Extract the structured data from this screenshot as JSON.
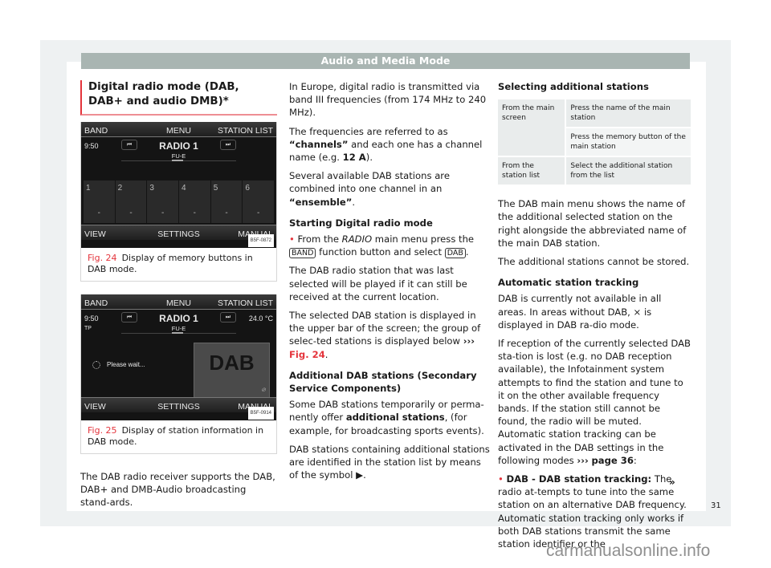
{
  "header": {
    "title": "Audio and Media Mode"
  },
  "section": {
    "title": "Digital radio mode (DAB, DAB+ and audio DMB)*"
  },
  "figures": [
    {
      "label": "Fig. 24",
      "caption": "Display of memory buttons in DAB mode.",
      "screen": {
        "top_left": "BAND",
        "top_center": "MENU",
        "top_right": "STATION LIST",
        "time": "9:50",
        "station": "RADIO 1",
        "sub": "FU-E",
        "prev_icon": "⏮",
        "next_icon": "⏭",
        "presets": [
          {
            "number": "1",
            "name": "-"
          },
          {
            "number": "2",
            "name": "-"
          },
          {
            "number": "3",
            "name": "-"
          },
          {
            "number": "4",
            "name": "-"
          },
          {
            "number": "5",
            "name": "-"
          },
          {
            "number": "6",
            "name": "-"
          }
        ],
        "page_dots": "• • •",
        "bottom_left": "VIEW",
        "bottom_center": "SETTINGS",
        "bottom_right": "MANUAL",
        "code": "B5F-0872"
      }
    },
    {
      "label": "Fig. 25",
      "caption": "Display of station information in DAB mode.",
      "screen": {
        "top_left": "BAND",
        "top_center": "MENU",
        "top_right": "STATION LIST",
        "time": "9:50",
        "tp": "TP",
        "temperature": "24.0 °C",
        "station": "RADIO 1",
        "sub": "FU-E",
        "prev_icon": "⏮",
        "next_icon": "⏭",
        "status": "Please wait...",
        "logo": "DAB",
        "no_image_icon": "⊘",
        "bottom_left": "VIEW",
        "bottom_center": "SETTINGS",
        "bottom_right": "MANUAL",
        "code": "B5F-0914"
      }
    }
  ],
  "col1": {
    "para": "The DAB radio receiver supports the DAB, DAB+ and DMB-Audio broadcasting stand-ards."
  },
  "col2": {
    "p1": "In Europe, digital radio is transmitted via band III frequencies (from 174 MHz to 240 MHz).",
    "p2_a": "The frequencies are referred to as ",
    "p2_b": "“channels”",
    "p2_c": " and each one has a channel name (e.g. ",
    "p2_d": "12  A",
    "p2_e": ").",
    "p3_a": "Several available DAB stations are combined into one channel in an ",
    "p3_b": "“ensemble”",
    "p3_c": ".",
    "h1": "Starting Digital radio mode",
    "b1_a": "From the ",
    "b1_b": "RADIO",
    "b1_c": " main menu press the ",
    "b1_key1": "BAND",
    "b1_d": " function button and select ",
    "b1_key2": "DAB",
    "b1_e": ".",
    "p4": "The DAB radio station that was last selected will be played if it can still be received at the current location.",
    "p5_a": "The selected DAB station is displayed in the upper bar of the screen; the group of selec-ted stations is displayed below ",
    "p5_arrow": "›››",
    "p5_ref": "Fig. 24",
    "p5_b": ".",
    "h2": "Additional DAB stations (Secondary Service Components)",
    "p6_a": "Some DAB stations temporarily or perma-nently offer ",
    "p6_b": "additional stations",
    "p6_c": ", (for example, for broadcasting sports events).",
    "p7_a": "DAB stations containing additional stations are identified in the station list by means of the symbol ",
    "p7_symbol": "▶",
    "p7_b": "."
  },
  "col3": {
    "h1": "Selecting additional stations",
    "table": [
      {
        "from": "From the main screen",
        "actions": [
          "Press the name of the main station",
          "Press the memory button of the main station"
        ]
      },
      {
        "from": "From the station list",
        "actions": [
          "Select the additional station from the list"
        ]
      }
    ],
    "p1": "The DAB main menu shows the name of the additional selected station on the right alongside the abbreviated name of the main DAB station.",
    "p2": "The additional stations cannot be stored.",
    "h2": "Automatic station tracking",
    "p3_a": "DAB is currently not available in all areas. In areas without DAB, ",
    "p3_icon": "⨯",
    "p3_b": " is displayed in DAB ra-dio mode.",
    "p4_a": "If reception of the currently selected DAB sta-tion is lost (e.g. no DAB reception available), the Infotainment system attempts to find the station and tune to it on the other available frequency bands. If the station still cannot be found, the radio will be muted. Automatic station tracking can be activated in the DAB settings in the following modes ",
    "p4_arrow": "›››",
    "p4_ref": "page 36",
    "p4_b": ":",
    "b1_label": "DAB - DAB station tracking:",
    "b1_text": " The radio at-tempts to tune into the same station on an alternative DAB frequency. Automatic station tracking only works if both DAB stations transmit the same station identifier or the"
  },
  "continue_marker": "»",
  "page_number": "31",
  "watermark": "carmanualsonline.info"
}
